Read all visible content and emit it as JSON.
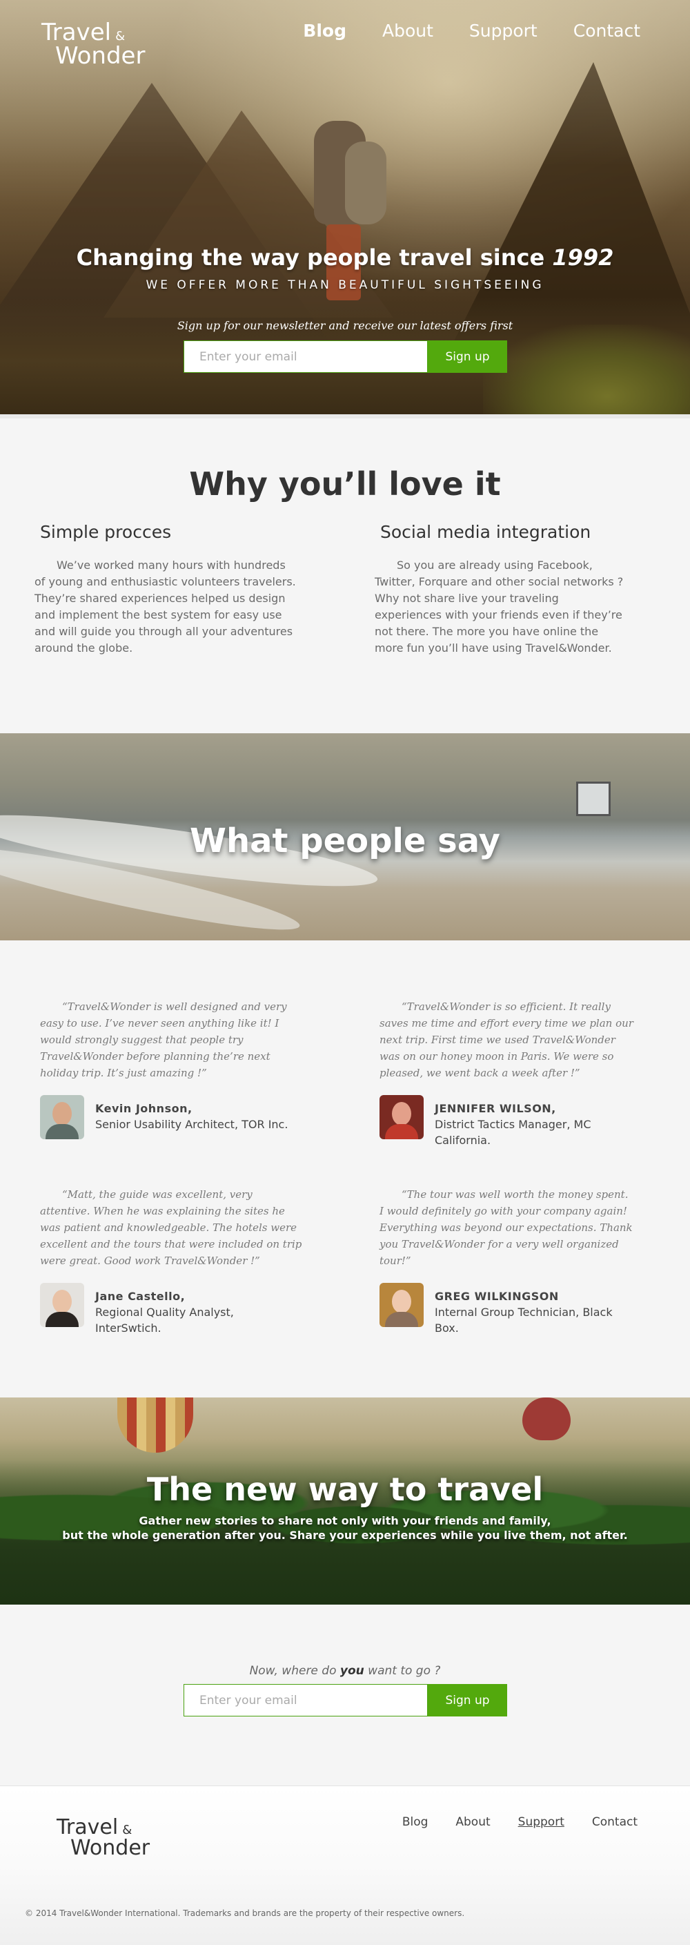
{
  "brand": {
    "line1": "Travel",
    "amp": "&",
    "line2": "Wonder"
  },
  "nav": [
    {
      "label": "Blog"
    },
    {
      "label": "About"
    },
    {
      "label": "Support"
    },
    {
      "label": "Contact"
    }
  ],
  "hero": {
    "title_pre": "Changing the way ",
    "title_bold": "people",
    "title_mid": " travel since ",
    "title_year": "1992",
    "subtitle": "WE OFFER MORE THAN BEAUTIFUL SIGHTSEEING",
    "newsletter_note": "Sign up for our newsletter and receive our latest offers first",
    "email_placeholder": "Enter your email",
    "signup_label": "Sign up"
  },
  "why": {
    "title": "Why you’ll love it",
    "features": [
      {
        "title": "Simple procces",
        "text": "We’ve  worked many hours with hundreds of young and enthusiastic volunteers travelers. They’re shared experiences helped us design and implement the best system for easy use and will guide you through all your adventures around the  globe."
      },
      {
        "title": "Social media integration",
        "text": "So you are already using Facebook, Twitter, Forquare and other social networks ? Why not share live your traveling experiences with your friends even if they’re not there. The more you have online the more fun you’ll have using Travel&Wonder."
      }
    ]
  },
  "testimonials_banner": {
    "title": "What people say"
  },
  "testimonials": [
    {
      "quote": "“Travel&Wonder is well designed and very easy to use. I’ve never seen anything like it! I would strongly suggest that people try Travel&Wonder before planning the’re next holiday trip. It’s just amazing !”",
      "name": "Kevin Johnson,",
      "role": "Senior Usability Architect, TOR Inc."
    },
    {
      "quote": "“Travel&Wonder is so efficient. It really saves me time and effort every time we plan our next trip. First time we used Travel&Wonder was on our honey moon in Paris. We were so pleased, we went back a week after !”",
      "name": "JENNIFER WILSON,",
      "role": "District Tactics Manager, MC California."
    },
    {
      "quote": "“Matt, the guide was excellent, very attentive. When he was explaining the sites he was patient and knowledgeable. The hotels were excellent and the tours that were included on trip were great.  Good work Travel&Wonder !”",
      "name": "Jane Castello,",
      "role": "Regional Quality Analyst, InterSwtich."
    },
    {
      "quote": "“The tour was well worth the money spent. I would definitely go with your company again! Everything was beyond our expectations. Thank you Travel&Wonder for a very well organized tour!”",
      "name": "GREG WILKINGSON",
      "role": "Internal Group Technician, Black Box."
    }
  ],
  "newway": {
    "title": "The new way to travel",
    "line1": "Gather new stories to share not only with your friends and family,",
    "line2": "but the whole generation after you. Share your experiences while you live them, not after."
  },
  "cta": {
    "q_pre": "Now, where do ",
    "q_bold": "you",
    "q_post": " want to go ?",
    "email_placeholder": "Enter your email",
    "signup_label": "Sign up"
  },
  "footer": {
    "nav": [
      {
        "label": "Blog"
      },
      {
        "label": "About"
      },
      {
        "label": "Support"
      },
      {
        "label": "Contact"
      }
    ],
    "copyright": "© 2014 Travel&Wonder International. Trademarks and brands are the property of their respective owners."
  },
  "colors": {
    "accent": "#53a90d",
    "heading": "#333333",
    "text": "#6a6a6a"
  }
}
